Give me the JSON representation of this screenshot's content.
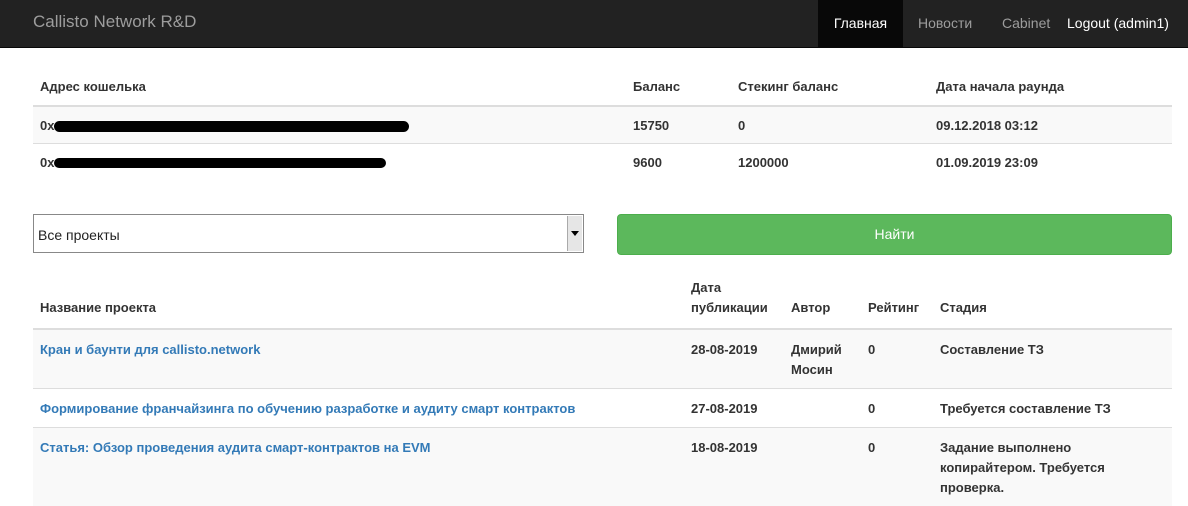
{
  "navbar": {
    "brand": "Callisto Network R&D",
    "items": [
      {
        "label": "Главная",
        "active": true
      },
      {
        "label": "Новости",
        "active": false
      },
      {
        "label": "Cabinet",
        "active": false
      },
      {
        "label": "Logout (admin1)",
        "active": false
      }
    ]
  },
  "wallets": {
    "headers": [
      "Адрес кошелька",
      "Баланс",
      "Стекинг баланс",
      "Дата начала раунда"
    ],
    "rows": [
      {
        "address_prefix": "0x",
        "balance": "15750",
        "staking": "0",
        "round_start": "09.12.2018 03:12"
      },
      {
        "address_prefix": "0x",
        "balance": "9600",
        "staking": "1200000",
        "round_start": "01.09.2019 23:09"
      }
    ]
  },
  "filter": {
    "selected": "Все проекты",
    "button_label": "Найти"
  },
  "projects": {
    "headers": {
      "name": "Название проекта",
      "date_line1": "Дата",
      "date_line2": "публикации",
      "author": "Автор",
      "rating": "Рейтинг",
      "stage": "Стадия"
    },
    "rows": [
      {
        "name": "Кран и баунти для callisto.network",
        "date": "28-08-2019",
        "author": "Дмирий Мосин",
        "rating": "0",
        "stage": "Составление ТЗ"
      },
      {
        "name": "Формирование франчайзинга по обучению разработке и аудиту смарт контрактов",
        "date": "27-08-2019",
        "author": "",
        "rating": "0",
        "stage": "Требуется составление ТЗ"
      },
      {
        "name": "Статья: Обзор проведения аудита смарт-контрактов на EVM",
        "date": "18-08-2019",
        "author": "",
        "rating": "0",
        "stage": "Задание выполнено копирайтером. Требуется проверка."
      }
    ]
  },
  "colors": {
    "navbar_bg": "#222222",
    "button_green": "#5cb85c",
    "link_blue": "#337ab7"
  }
}
